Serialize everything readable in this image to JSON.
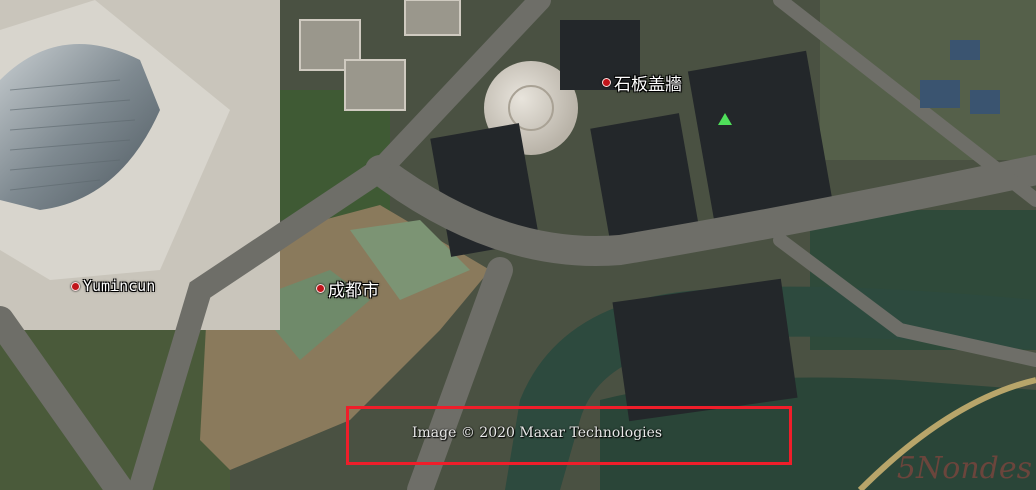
{
  "map": {
    "imagery": "satellite",
    "places": [
      {
        "id": "shibangao",
        "label": "石板盖牆"
      },
      {
        "id": "chengdu",
        "label": "成都市"
      },
      {
        "id": "yumincun",
        "label": "Yumincun"
      }
    ],
    "poi_icon": "green-triangle-marker-icon",
    "attribution": "Image © 2020 Maxar Technologies",
    "watermark": "5Nondes",
    "colors": {
      "pin": "#c0151b",
      "highlight_box": "#ef1e2a",
      "poi_marker": "#4fe05a",
      "label_text": "#ffffff"
    }
  }
}
